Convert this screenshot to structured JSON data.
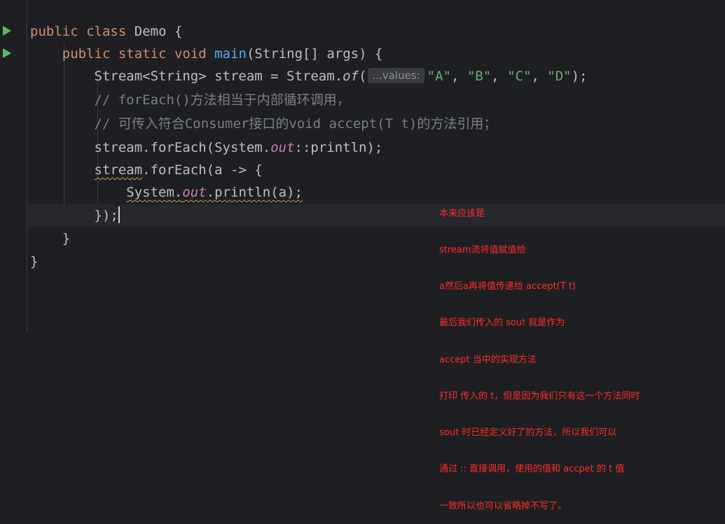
{
  "colors": {
    "background": "#1e1f22",
    "keyword": "#cf8e6d",
    "method": "#56a8f5",
    "string": "#6aab73",
    "static_field": "#c77dbb",
    "comment": "#7a7e85",
    "annotation_red": "#ff2b2b",
    "run_gutter_icon": "#5fb865"
  },
  "gutter": {
    "run_icons": [
      "run-class-icon",
      "run-main-icon"
    ]
  },
  "code": {
    "line1": {
      "kw1": "public",
      "kw2": "class",
      "name": "Demo",
      "brace": " {"
    },
    "line2": {
      "kw1": "public",
      "kw2": "static",
      "kw3": "void",
      "method": "main",
      "params": "(String[] args) {"
    },
    "line3": {
      "prefix": "Stream<String> stream = Stream.",
      "call": "of",
      "open": "(",
      "hint": "...values:",
      "s1": "\"A\"",
      "s2": "\"B\"",
      "s3": "\"C\"",
      "s4": "\"D\"",
      "sep": ", ",
      "close": ");"
    },
    "line4": {
      "comment": "// forEach()方法相当于内部循环调用，"
    },
    "line5": {
      "comment": "// 可传入符合Consumer接口的void accept(T t)的方法引用；"
    },
    "line6": {
      "prefix": "stream.forEach(System.",
      "field": "out",
      "suffix": "::println);"
    },
    "line7": {
      "squiggled": "stream",
      "rest": ".forEach(a -> {"
    },
    "line8": {
      "prefix": "System.",
      "field": "out",
      "suffix": ".println(a);"
    },
    "line9": {
      "text": "});"
    },
    "line10": {
      "text": "}"
    },
    "line11": {
      "text": "}"
    }
  },
  "annotation": {
    "lines": [
      "本来应该是",
      "stream流将值赋值给",
      "a然后a再将值传递给 accept(T t)",
      "最后我们传入的 sout 就是作为",
      "accept 当中的实现方法",
      "打印 传入的 t，但是因为我们只有这一个方法同时",
      "sout 时已经定义好了的方法，所以我们可以",
      "通过 :: 直接调用，使用的值和 accpet 的 t 值",
      "一致所以也可以省略掉不写了。"
    ]
  }
}
